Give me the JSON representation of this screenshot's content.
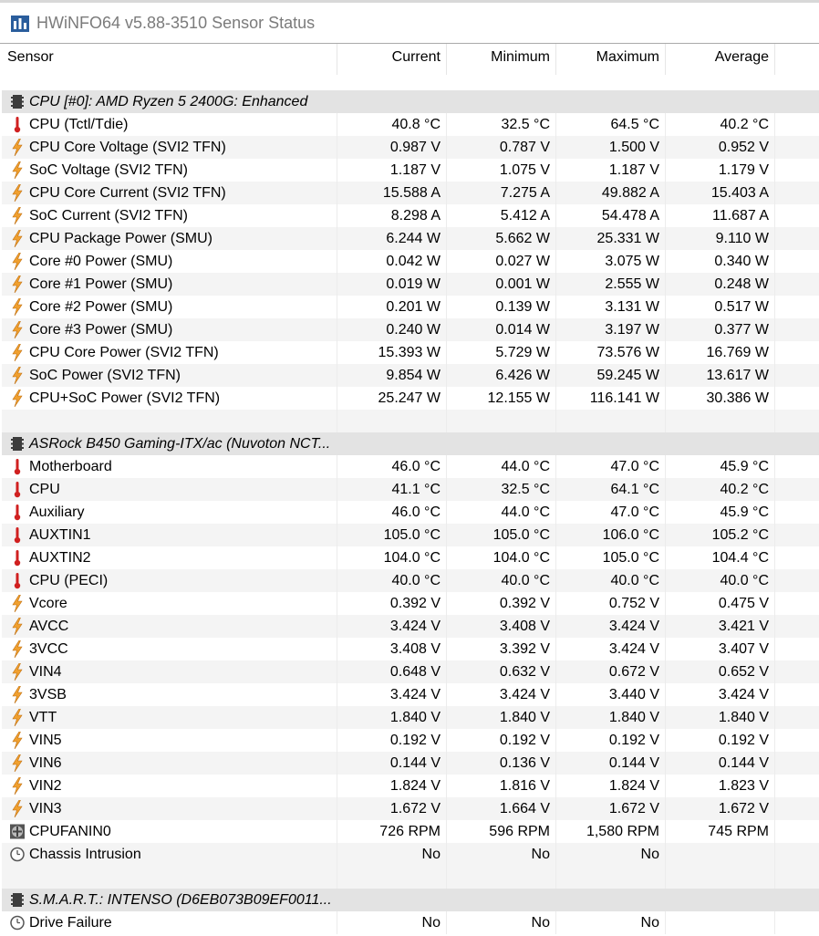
{
  "window": {
    "title": "HWiNFO64 v5.88-3510 Sensor Status"
  },
  "header": {
    "sensor": "Sensor",
    "current": "Current",
    "minimum": "Minimum",
    "maximum": "Maximum",
    "average": "Average"
  },
  "colors": {
    "thermometer": "#d02020",
    "bolt": "#f0a030",
    "group_bg": "#e3e3e3"
  },
  "rows": [
    {
      "type": "group",
      "icon": "chip-icon",
      "name": "CPU [#0]: AMD Ryzen 5 2400G: Enhanced"
    },
    {
      "type": "item",
      "icon": "thermometer-icon",
      "name": "CPU (Tctl/Tdie)",
      "cur": "40.8 °C",
      "min": "32.5 °C",
      "max": "64.5 °C",
      "avg": "40.2 °C"
    },
    {
      "type": "item",
      "icon": "bolt-icon",
      "name": "CPU Core Voltage (SVI2 TFN)",
      "cur": "0.987 V",
      "min": "0.787 V",
      "max": "1.500 V",
      "avg": "0.952 V"
    },
    {
      "type": "item",
      "icon": "bolt-icon",
      "name": "SoC Voltage (SVI2 TFN)",
      "cur": "1.187 V",
      "min": "1.075 V",
      "max": "1.187 V",
      "avg": "1.179 V"
    },
    {
      "type": "item",
      "icon": "bolt-icon",
      "name": "CPU Core Current (SVI2 TFN)",
      "cur": "15.588 A",
      "min": "7.275 A",
      "max": "49.882 A",
      "avg": "15.403 A"
    },
    {
      "type": "item",
      "icon": "bolt-icon",
      "name": "SoC Current (SVI2 TFN)",
      "cur": "8.298 A",
      "min": "5.412 A",
      "max": "54.478 A",
      "avg": "11.687 A"
    },
    {
      "type": "item",
      "icon": "bolt-icon",
      "name": "CPU Package Power (SMU)",
      "cur": "6.244 W",
      "min": "5.662 W",
      "max": "25.331 W",
      "avg": "9.110 W"
    },
    {
      "type": "item",
      "icon": "bolt-icon",
      "name": "Core #0 Power (SMU)",
      "cur": "0.042 W",
      "min": "0.027 W",
      "max": "3.075 W",
      "avg": "0.340 W"
    },
    {
      "type": "item",
      "icon": "bolt-icon",
      "name": "Core #1 Power (SMU)",
      "cur": "0.019 W",
      "min": "0.001 W",
      "max": "2.555 W",
      "avg": "0.248 W"
    },
    {
      "type": "item",
      "icon": "bolt-icon",
      "name": "Core #2 Power (SMU)",
      "cur": "0.201 W",
      "min": "0.139 W",
      "max": "3.131 W",
      "avg": "0.517 W"
    },
    {
      "type": "item",
      "icon": "bolt-icon",
      "name": "Core #3 Power (SMU)",
      "cur": "0.240 W",
      "min": "0.014 W",
      "max": "3.197 W",
      "avg": "0.377 W"
    },
    {
      "type": "item",
      "icon": "bolt-icon",
      "name": "CPU Core Power (SVI2 TFN)",
      "cur": "15.393 W",
      "min": "5.729 W",
      "max": "73.576 W",
      "avg": "16.769 W"
    },
    {
      "type": "item",
      "icon": "bolt-icon",
      "name": "SoC Power (SVI2 TFN)",
      "cur": "9.854 W",
      "min": "6.426 W",
      "max": "59.245 W",
      "avg": "13.617 W"
    },
    {
      "type": "item",
      "icon": "bolt-icon",
      "name": "CPU+SoC Power (SVI2 TFN)",
      "cur": "25.247 W",
      "min": "12.155 W",
      "max": "116.141 W",
      "avg": "30.386 W"
    },
    {
      "type": "blank"
    },
    {
      "type": "group",
      "icon": "chip-icon",
      "name": "ASRock B450 Gaming-ITX/ac (Nuvoton NCT..."
    },
    {
      "type": "item",
      "icon": "thermometer-icon",
      "name": "Motherboard",
      "cur": "46.0 °C",
      "min": "44.0 °C",
      "max": "47.0 °C",
      "avg": "45.9 °C"
    },
    {
      "type": "item",
      "icon": "thermometer-icon",
      "name": "CPU",
      "cur": "41.1 °C",
      "min": "32.5 °C",
      "max": "64.1 °C",
      "avg": "40.2 °C"
    },
    {
      "type": "item",
      "icon": "thermometer-icon",
      "name": "Auxiliary",
      "cur": "46.0 °C",
      "min": "44.0 °C",
      "max": "47.0 °C",
      "avg": "45.9 °C"
    },
    {
      "type": "item",
      "icon": "thermometer-icon",
      "name": "AUXTIN1",
      "cur": "105.0 °C",
      "min": "105.0 °C",
      "max": "106.0 °C",
      "avg": "105.2 °C"
    },
    {
      "type": "item",
      "icon": "thermometer-icon",
      "name": "AUXTIN2",
      "cur": "104.0 °C",
      "min": "104.0 °C",
      "max": "105.0 °C",
      "avg": "104.4 °C"
    },
    {
      "type": "item",
      "icon": "thermometer-icon",
      "name": "CPU (PECI)",
      "cur": "40.0 °C",
      "min": "40.0 °C",
      "max": "40.0 °C",
      "avg": "40.0 °C"
    },
    {
      "type": "item",
      "icon": "bolt-icon",
      "name": "Vcore",
      "cur": "0.392 V",
      "min": "0.392 V",
      "max": "0.752 V",
      "avg": "0.475 V"
    },
    {
      "type": "item",
      "icon": "bolt-icon",
      "name": "AVCC",
      "cur": "3.424 V",
      "min": "3.408 V",
      "max": "3.424 V",
      "avg": "3.421 V"
    },
    {
      "type": "item",
      "icon": "bolt-icon",
      "name": "3VCC",
      "cur": "3.408 V",
      "min": "3.392 V",
      "max": "3.424 V",
      "avg": "3.407 V"
    },
    {
      "type": "item",
      "icon": "bolt-icon",
      "name": "VIN4",
      "cur": "0.648 V",
      "min": "0.632 V",
      "max": "0.672 V",
      "avg": "0.652 V"
    },
    {
      "type": "item",
      "icon": "bolt-icon",
      "name": "3VSB",
      "cur": "3.424 V",
      "min": "3.424 V",
      "max": "3.440 V",
      "avg": "3.424 V"
    },
    {
      "type": "item",
      "icon": "bolt-icon",
      "name": "VTT",
      "cur": "1.840 V",
      "min": "1.840 V",
      "max": "1.840 V",
      "avg": "1.840 V"
    },
    {
      "type": "item",
      "icon": "bolt-icon",
      "name": "VIN5",
      "cur": "0.192 V",
      "min": "0.192 V",
      "max": "0.192 V",
      "avg": "0.192 V"
    },
    {
      "type": "item",
      "icon": "bolt-icon",
      "name": "VIN6",
      "cur": "0.144 V",
      "min": "0.136 V",
      "max": "0.144 V",
      "avg": "0.144 V"
    },
    {
      "type": "item",
      "icon": "bolt-icon",
      "name": "VIN2",
      "cur": "1.824 V",
      "min": "1.816 V",
      "max": "1.824 V",
      "avg": "1.823 V"
    },
    {
      "type": "item",
      "icon": "bolt-icon",
      "name": "VIN3",
      "cur": "1.672 V",
      "min": "1.664 V",
      "max": "1.672 V",
      "avg": "1.672 V"
    },
    {
      "type": "item",
      "icon": "fan-icon",
      "name": "CPUFANIN0",
      "cur": "726 RPM",
      "min": "596 RPM",
      "max": "1,580 RPM",
      "avg": "745 RPM"
    },
    {
      "type": "item",
      "icon": "clock-icon",
      "name": "Chassis Intrusion",
      "cur": "No",
      "min": "No",
      "max": "No",
      "avg": ""
    },
    {
      "type": "blank"
    },
    {
      "type": "group",
      "icon": "chip-icon",
      "name": "S.M.A.R.T.: INTENSO (D6EB073B09EF0011..."
    },
    {
      "type": "item",
      "icon": "clock-icon",
      "name": "Drive Failure",
      "cur": "No",
      "min": "No",
      "max": "No",
      "avg": ""
    }
  ]
}
